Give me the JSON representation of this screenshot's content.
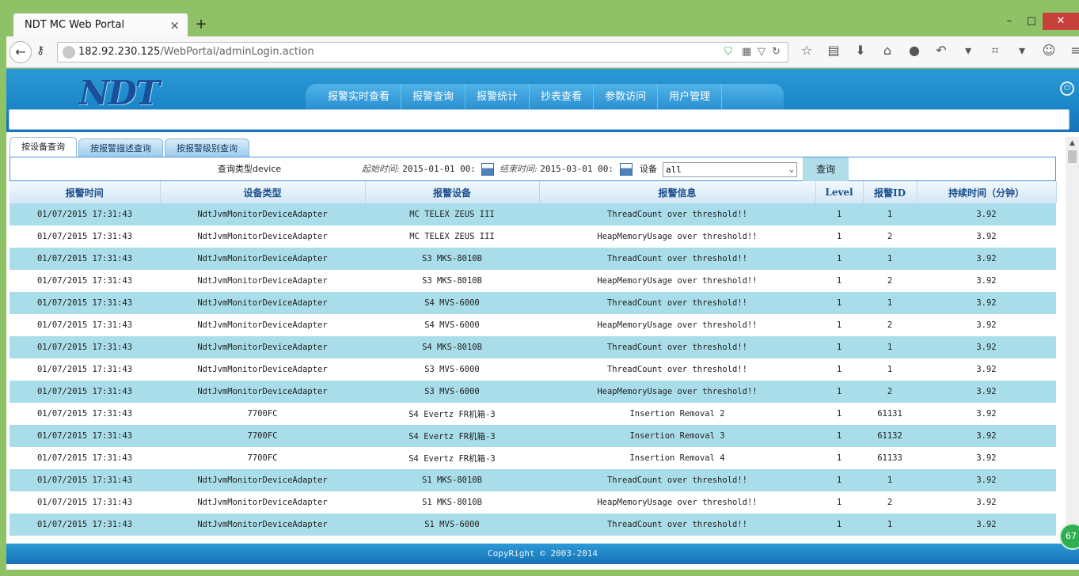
{
  "browser": {
    "tab_title": "NDT MC Web Portal",
    "tab_close": "×",
    "new_tab": "+",
    "url_host": "182.92.230.125",
    "url_path": "/WebPortal/adminLogin.action",
    "window_min": "–",
    "window_max": "□",
    "window_close": "✕"
  },
  "header": {
    "logo": "NDT",
    "nav": [
      "报警实时查看",
      "报警查询",
      "报警统计",
      "抄表查看",
      "参数访问",
      "用户管理"
    ]
  },
  "tabs": [
    "按设备查询",
    "按报警描述查询",
    "按报警级别查询"
  ],
  "query": {
    "type_label": "查询类型device",
    "start_label": "起始时间:",
    "start_value": "2015-01-01 00:",
    "end_label": "结束时间:",
    "end_value": "2015-03-01 00:",
    "device_label": "设备",
    "device_value": "all",
    "button": "查询"
  },
  "table": {
    "headers": [
      "报警时间",
      "设备类型",
      "报警设备",
      "报警信息",
      "Level",
      "报警ID",
      "持续时间（分钟）"
    ],
    "rows": [
      [
        "01/07/2015 17:31:43",
        "NdtJvmMonitorDeviceAdapter",
        "MC TELEX ZEUS III",
        "ThreadCount over threshold!!",
        "1",
        "1",
        "3.92"
      ],
      [
        "01/07/2015 17:31:43",
        "NdtJvmMonitorDeviceAdapter",
        "MC TELEX ZEUS III",
        "HeapMemoryUsage over threshold!!",
        "1",
        "2",
        "3.92"
      ],
      [
        "01/07/2015 17:31:43",
        "NdtJvmMonitorDeviceAdapter",
        "S3 MKS-8010B",
        "ThreadCount over threshold!!",
        "1",
        "1",
        "3.92"
      ],
      [
        "01/07/2015 17:31:43",
        "NdtJvmMonitorDeviceAdapter",
        "S3 MKS-8010B",
        "HeapMemoryUsage over threshold!!",
        "1",
        "2",
        "3.92"
      ],
      [
        "01/07/2015 17:31:43",
        "NdtJvmMonitorDeviceAdapter",
        "S4 MVS-6000",
        "ThreadCount over threshold!!",
        "1",
        "1",
        "3.92"
      ],
      [
        "01/07/2015 17:31:43",
        "NdtJvmMonitorDeviceAdapter",
        "S4 MVS-6000",
        "HeapMemoryUsage over threshold!!",
        "1",
        "2",
        "3.92"
      ],
      [
        "01/07/2015 17:31:43",
        "NdtJvmMonitorDeviceAdapter",
        "S4 MKS-8010B",
        "ThreadCount over threshold!!",
        "1",
        "1",
        "3.92"
      ],
      [
        "01/07/2015 17:31:43",
        "NdtJvmMonitorDeviceAdapter",
        "S3 MVS-6000",
        "ThreadCount over threshold!!",
        "1",
        "1",
        "3.92"
      ],
      [
        "01/07/2015 17:31:43",
        "NdtJvmMonitorDeviceAdapter",
        "S3 MVS-6000",
        "HeapMemoryUsage over threshold!!",
        "1",
        "2",
        "3.92"
      ],
      [
        "01/07/2015 17:31:43",
        "7700FC",
        "S4 Evertz FR机箱-3",
        "Insertion Removal 2",
        "1",
        "61131",
        "3.92"
      ],
      [
        "01/07/2015 17:31:43",
        "7700FC",
        "S4 Evertz FR机箱-3",
        "Insertion Removal 3",
        "1",
        "61132",
        "3.92"
      ],
      [
        "01/07/2015 17:31:43",
        "7700FC",
        "S4 Evertz FR机箱-3",
        "Insertion Removal 4",
        "1",
        "61133",
        "3.92"
      ],
      [
        "01/07/2015 17:31:43",
        "NdtJvmMonitorDeviceAdapter",
        "S1 MKS-8010B",
        "ThreadCount over threshold!!",
        "1",
        "1",
        "3.92"
      ],
      [
        "01/07/2015 17:31:43",
        "NdtJvmMonitorDeviceAdapter",
        "S1 MKS-8010B",
        "HeapMemoryUsage over threshold!!",
        "1",
        "2",
        "3.92"
      ],
      [
        "01/07/2015 17:31:43",
        "NdtJvmMonitorDeviceAdapter",
        "S1 MVS-6000",
        "ThreadCount over threshold!!",
        "1",
        "1",
        "3.92"
      ]
    ]
  },
  "footer": "CopyRight © 2003-2014",
  "badge": "67"
}
